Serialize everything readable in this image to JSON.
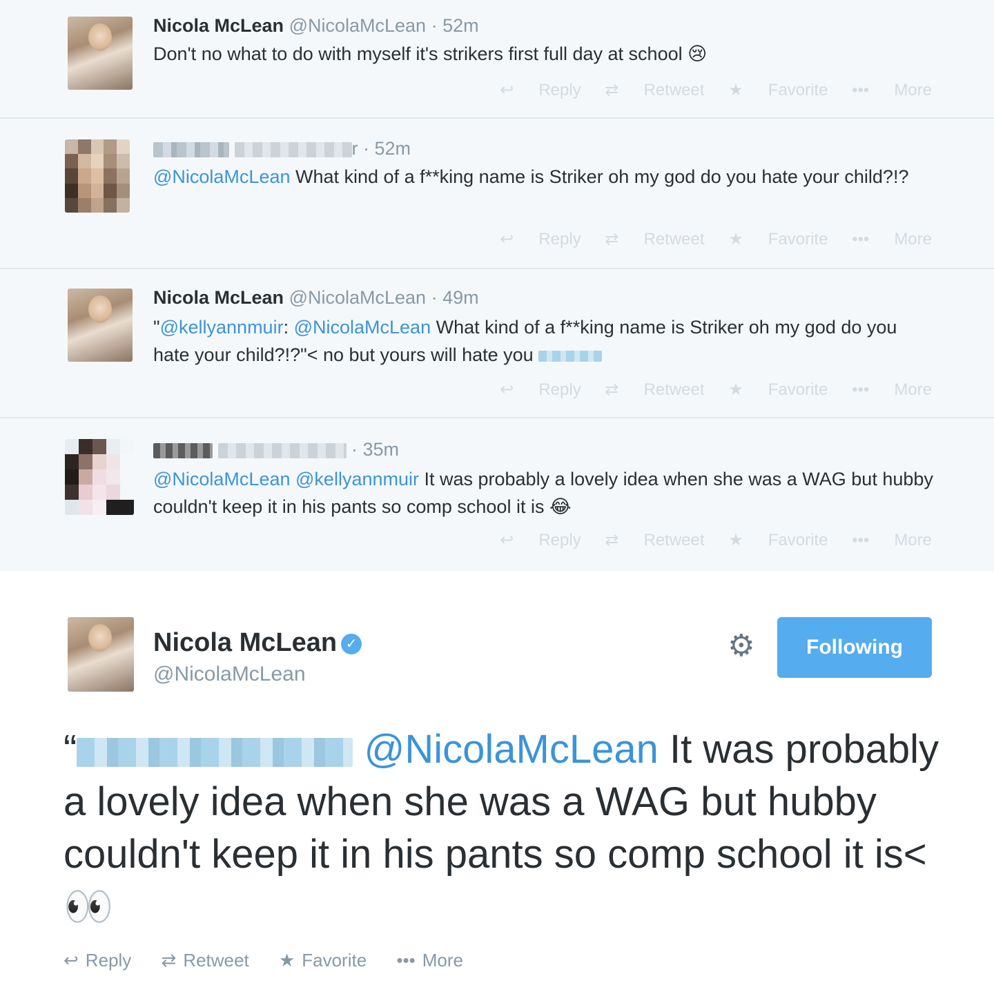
{
  "colors": {
    "link": "#3b94d9",
    "button": "#55acee",
    "muted": "#8899a6",
    "thread_bg": "#f5f8fa"
  },
  "thread": [
    {
      "name": "Nicola McLean",
      "handle": "@NicolaMcLean",
      "time": "· 52m",
      "text": "Don't no what to do with myself it's strikers first full day at school 😢"
    },
    {
      "name_tail": "r",
      "time": "· 52m",
      "mention": "@NicolaMcLean",
      "text": " What kind of a f**king name is Striker oh my god do you hate your child?!?"
    },
    {
      "name": "Nicola McLean",
      "handle": "@NicolaMcLean",
      "time": "· 49m",
      "prefix": "\"",
      "mention1": "@kellyannmuir",
      "colon": ":",
      "mention2": "@NicolaMcLean",
      "text": " What kind of a f**king name is Striker oh my god do you hate your child?!?\"< no but yours will hate you"
    },
    {
      "time": "· 35m",
      "mention1": "@NicolaMcLean",
      "mention2": "@kellyannmuir",
      "text": " It was probably a lovely idea when she was a WAG but hubby couldn't keep it in his pants so comp school it is 😂"
    }
  ],
  "actions": {
    "reply": "Reply",
    "retweet": "Retweet",
    "favorite": "Favorite",
    "more": "More"
  },
  "main": {
    "name": "Nicola McLean",
    "handle": "@NicolaMcLean",
    "button": "Following",
    "open_quote": "“",
    "mention": "@NicolaMcLean",
    "text": " It was probably a lovely idea when she was a WAG but hubby couldn't keep it in his pants so comp school it is< 👀"
  }
}
